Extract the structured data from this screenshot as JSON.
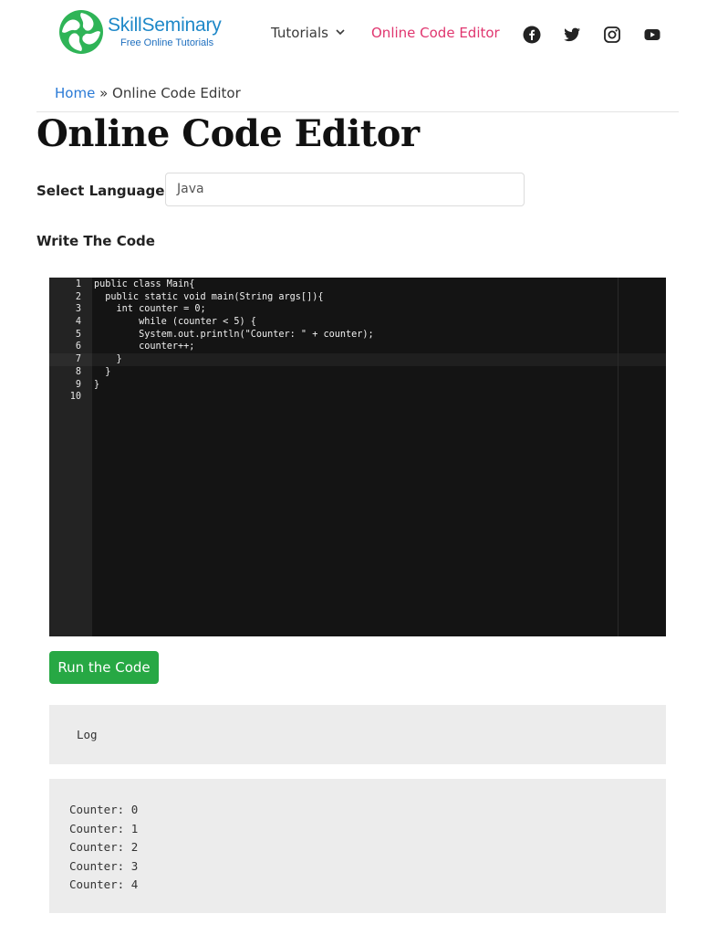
{
  "header": {
    "logo_title": "SkillSeminary",
    "logo_subtitle": "Free Online Tutorials",
    "nav": {
      "tutorials_label": "Tutorials",
      "active_label": "Online Code Editor"
    },
    "social_icons": [
      "facebook-icon",
      "twitter-icon",
      "instagram-icon",
      "youtube-icon"
    ]
  },
  "breadcrumb": {
    "home": "Home",
    "separator": "»",
    "current": "Online Code Editor"
  },
  "page_title": "Online Code Editor",
  "form": {
    "language_label": "Select Language",
    "language_value": "Java",
    "code_label": "Write The Code"
  },
  "editor": {
    "lines": [
      {
        "n": "1",
        "code": "public class Main{"
      },
      {
        "n": "2",
        "code": "  public static void main(String args[]){"
      },
      {
        "n": "3",
        "code": "    int counter = 0;"
      },
      {
        "n": "4",
        "code": "        while (counter < 5) {"
      },
      {
        "n": "5",
        "code": "        System.out.println(\"Counter: \" + counter);"
      },
      {
        "n": "6",
        "code": "        counter++;"
      },
      {
        "n": "7",
        "code": "    }"
      },
      {
        "n": "8",
        "code": "  }"
      },
      {
        "n": "9",
        "code": "}"
      },
      {
        "n": "10",
        "code": ""
      }
    ],
    "active_line": 7
  },
  "run_button_label": "Run the Code",
  "log": {
    "label": "Log",
    "output": [
      "Counter: 0",
      "Counter: 1",
      "Counter: 2",
      "Counter: 3",
      "Counter: 4"
    ]
  },
  "colors": {
    "brand_blue": "#1e88c8",
    "nav_active": "#e0366f",
    "run_button": "#27a844",
    "editor_bg": "#141414"
  }
}
